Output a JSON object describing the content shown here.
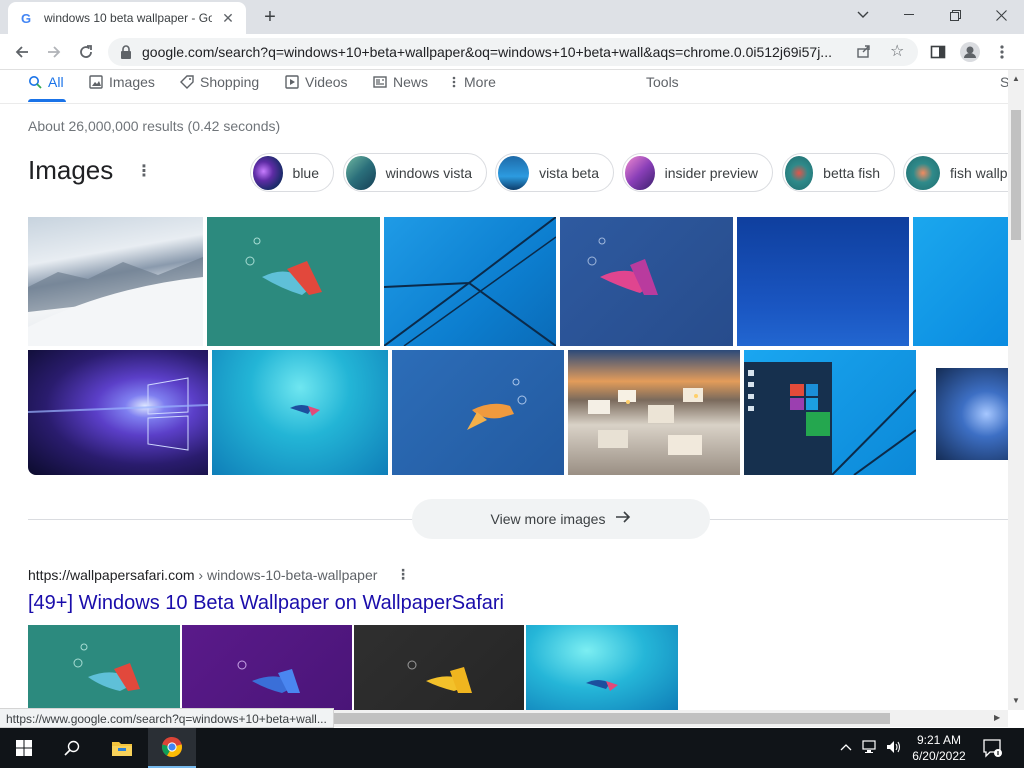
{
  "browser": {
    "tab_title": "windows 10 beta wallpaper - Goo",
    "tab_favicon": "G",
    "url": "google.com/search?q=windows+10+beta+wallpaper&oq=windows+10+beta+wall&aqs=chrome.0.0i512j69i57j..."
  },
  "search_tabs": [
    {
      "label": "All",
      "icon": "search-icon"
    },
    {
      "label": "Images",
      "icon": "image-icon"
    },
    {
      "label": "Shopping",
      "icon": "tag-icon"
    },
    {
      "label": "Videos",
      "icon": "play-icon"
    },
    {
      "label": "News",
      "icon": "news-icon"
    },
    {
      "label": "More",
      "icon": "more-vert-icon"
    }
  ],
  "tools_label": "Tools",
  "partial_right_label": "S",
  "results_stats": "About 26,000,000 results (0.42 seconds)",
  "images_section": {
    "heading": "Images",
    "chips": [
      "blue",
      "windows vista",
      "vista beta",
      "insider preview",
      "betta fish",
      "fish wallp"
    ],
    "view_more": "View more images"
  },
  "result": {
    "cite_domain": "https://wallpapersafari.com",
    "cite_path": " › windows-10-beta-wallpaper",
    "title": "[49+] Windows 10 Beta Wallpaper on WallpaperSafari"
  },
  "status_url": "https://www.google.com/search?q=windows+10+beta+wall...",
  "taskbar": {
    "time": "9:21 AM",
    "date": "6/20/2022"
  },
  "colors": {
    "link_blue": "#1a0dab",
    "accent_blue": "#1a73e8",
    "taskbar_bg": "#101418"
  }
}
